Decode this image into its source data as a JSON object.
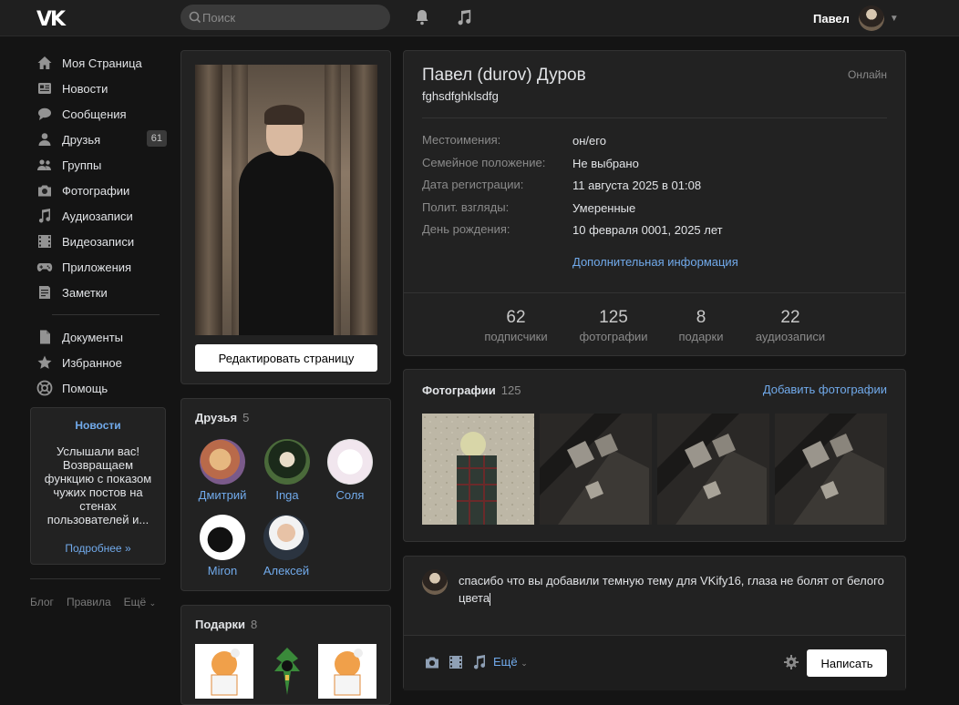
{
  "header": {
    "logo": "VK",
    "search_placeholder": "Поиск",
    "user_name": "Павел"
  },
  "sidebar": {
    "items": [
      {
        "label": "Моя Страница",
        "icon": "home-icon"
      },
      {
        "label": "Новости",
        "icon": "news-icon"
      },
      {
        "label": "Сообщения",
        "icon": "message-icon"
      },
      {
        "label": "Друзья",
        "icon": "user-icon",
        "badge": "61"
      },
      {
        "label": "Группы",
        "icon": "group-icon"
      },
      {
        "label": "Фотографии",
        "icon": "camera-icon"
      },
      {
        "label": "Аудиозаписи",
        "icon": "music-icon"
      },
      {
        "label": "Видеозаписи",
        "icon": "film-icon"
      },
      {
        "label": "Приложения",
        "icon": "gamepad-icon"
      },
      {
        "label": "Заметки",
        "icon": "notes-icon"
      }
    ],
    "items2": [
      {
        "label": "Документы",
        "icon": "document-icon"
      },
      {
        "label": "Избранное",
        "icon": "star-icon"
      },
      {
        "label": "Помощь",
        "icon": "help-icon"
      }
    ],
    "news_box": {
      "title": "Новости",
      "body": "Услышали вас! Возвращаем функцию с показом чужих постов на стенах пользователей и...",
      "more": "Подробнее »"
    },
    "footer": {
      "blog": "Блог",
      "rules": "Правила",
      "more": "Ещё"
    }
  },
  "profile_photo": {
    "edit_button": "Редактировать страницу"
  },
  "friends": {
    "title": "Друзья",
    "count": "5",
    "list": [
      {
        "name": "Дмитрий"
      },
      {
        "name": "Inga"
      },
      {
        "name": "Соля"
      },
      {
        "name": "Miron"
      },
      {
        "name": "Алексей"
      }
    ]
  },
  "gifts": {
    "title": "Подарки",
    "count": "8"
  },
  "info": {
    "name": "Павел (durov) Дуров",
    "status": "fghsdfghklsdfg",
    "online": "Онлайн",
    "rows": [
      {
        "key": "Местоимения:",
        "value": "он/его"
      },
      {
        "key": "Семейное положение:",
        "value": "Не выбрано"
      },
      {
        "key": "Дата регистрации:",
        "value": "11 августа 2025 в 01:08"
      },
      {
        "key": "Полит. взгляды:",
        "value": "Умеренные"
      },
      {
        "key": "День рождения:",
        "value": "10 февраля 0001, 2025 лет"
      }
    ],
    "more_info": "Дополнительная информация",
    "stats": [
      {
        "num": "62",
        "label": "подписчики"
      },
      {
        "num": "125",
        "label": "фотографии"
      },
      {
        "num": "8",
        "label": "подарки"
      },
      {
        "num": "22",
        "label": "аудиозаписи"
      }
    ]
  },
  "photos": {
    "title": "Фотографии",
    "count": "125",
    "add": "Добавить фотографии"
  },
  "post": {
    "text": "спасибо что вы добавили темную тему для VKify16, глаза не болят от белого цвета",
    "more": "Ещё",
    "submit": "Написать"
  }
}
